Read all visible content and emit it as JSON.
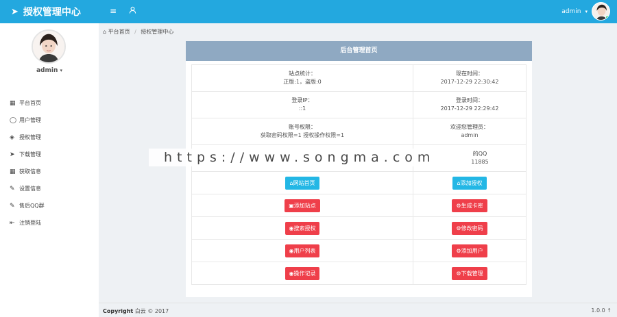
{
  "topbar": {
    "brand": "授权管理中心",
    "user_name": "admin",
    "icons": [
      "paper-plane-icon",
      "menu-icon",
      "user-icon",
      "caret-down-icon"
    ]
  },
  "sidebar": {
    "user_name": "admin",
    "items": [
      {
        "label": "平台首页",
        "icon": "grid-icon"
      },
      {
        "label": "用户管理",
        "icon": "user-icon"
      },
      {
        "label": "授权管理",
        "icon": "layers-icon"
      },
      {
        "label": "下载管理",
        "icon": "rocket-icon"
      },
      {
        "label": "获取信息",
        "icon": "grid-icon"
      },
      {
        "label": "设置信息",
        "icon": "edit-icon"
      },
      {
        "label": "售后QQ群",
        "icon": "edit-icon"
      },
      {
        "label": "注销登陆",
        "icon": "logout-icon"
      }
    ]
  },
  "breadcrumb": {
    "home": "平台首页",
    "current": "授权管理中心"
  },
  "panel": {
    "title": "后台管理首页",
    "rows": [
      {
        "left_label": "站点统计：",
        "left_value": "正版:1，盗版:0",
        "right_label": "现在时间：",
        "right_value": "2017-12-29 22:30:42"
      },
      {
        "left_label": "登录IP：",
        "left_value": "::1",
        "right_label": "登录时间：",
        "right_value": "2017-12-29 22:29:42"
      },
      {
        "left_label": "账号权限：",
        "left_value": "获取密码权限=1 授权操作权限=1",
        "right_label": "欢迎您管理员：",
        "right_value": "admin"
      },
      {
        "left_label": "",
        "left_value": "",
        "right_label": "的QQ",
        "right_value": "11885"
      }
    ],
    "buttons": [
      {
        "left": "网站首页",
        "right": "添加授权"
      },
      {
        "left": "添加站点",
        "right": "生成卡密"
      },
      {
        "left": "搜索授权",
        "right": "修改密码"
      },
      {
        "left": "用户列表",
        "right": "添加用户"
      },
      {
        "left": "操作记录",
        "right": "下载管理"
      }
    ]
  },
  "watermark": "https://www.songma.com",
  "footer": {
    "copyright_label": "Copyright",
    "copyright_text": "白云 © 2017",
    "version": "1.0.0"
  }
}
